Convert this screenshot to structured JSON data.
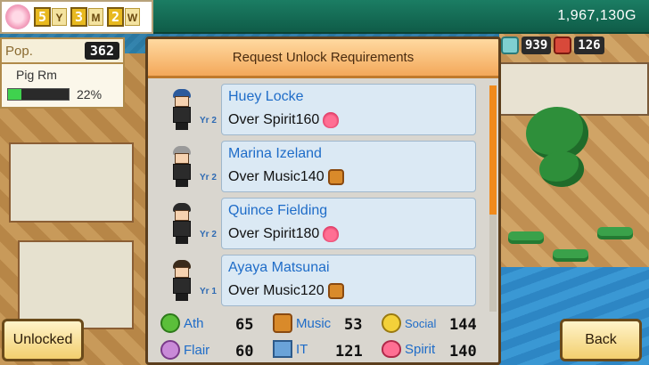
{
  "date": {
    "year_num": "5",
    "year_unit": "Y",
    "month_num": "3",
    "month_unit": "M",
    "week_num": "2",
    "week_unit": "W"
  },
  "money": "1,967,130G",
  "resources": [
    {
      "icon": "research-icon",
      "value": "939"
    },
    {
      "icon": "book-icon",
      "value": "126"
    }
  ],
  "population": {
    "label": "Pop.",
    "value": "362"
  },
  "room": {
    "name": "Pig Rm",
    "progress_pct": 22,
    "progress_text": "22%"
  },
  "modal": {
    "title": "Request Unlock Requirements",
    "students": [
      {
        "name": "Huey Locke",
        "year": "Yr 2",
        "requirement": "Over Spirit160",
        "req_icon": "heart-icon",
        "hair": "#2b5a9c"
      },
      {
        "name": "Marina Izeland",
        "year": "Yr 2",
        "requirement": "Over Music140",
        "req_icon": "music-icon",
        "hair": "#9a9a9a"
      },
      {
        "name": "Quince Fielding",
        "year": "Yr 2",
        "requirement": "Over Spirit180",
        "req_icon": "heart-icon",
        "hair": "#2a2a2a"
      },
      {
        "name": "Ayaya Matsunai",
        "year": "Yr 1",
        "requirement": "Over Music120",
        "req_icon": "music-icon",
        "hair": "#3a2a1a"
      }
    ],
    "stats": [
      {
        "key": "ath",
        "label": "Ath",
        "value": "65",
        "icon": "ath-icon"
      },
      {
        "key": "music",
        "label": "Music",
        "value": "53",
        "icon": "music-icon"
      },
      {
        "key": "social",
        "label": "Social",
        "value": "144",
        "icon": "social-icon"
      },
      {
        "key": "flair",
        "label": "Flair",
        "value": "60",
        "icon": "flair-icon"
      },
      {
        "key": "it",
        "label": "IT",
        "value": "121",
        "icon": "computer-icon"
      },
      {
        "key": "spirit",
        "label": "Spirit",
        "value": "140",
        "icon": "heart-icon"
      }
    ]
  },
  "buttons": {
    "unlocked": "Unlocked",
    "back": "Back"
  }
}
